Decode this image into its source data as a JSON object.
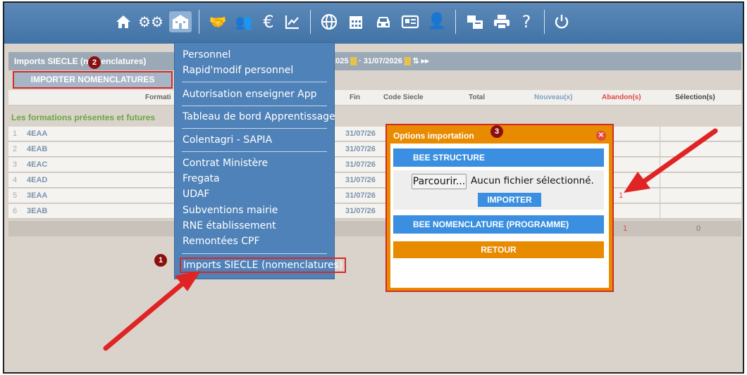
{
  "toolbar": {
    "icons": [
      "home-icon",
      "settings-icon",
      "school-icon",
      "handshake-icon",
      "group-icon",
      "euro-icon",
      "chart-icon",
      "globe-icon",
      "calendar-icon",
      "car-icon",
      "id-card-icon",
      "user-clock-icon",
      "mail-print-icon",
      "printer-icon",
      "help-icon",
      "power-icon"
    ],
    "glyph_help": "?",
    "glyph_euro": "€"
  },
  "page": {
    "title": "Imports SIECLE (nomenclatures)",
    "date_start": "2025",
    "date_end": "31/07/2026",
    "import_button": "IMPORTER NOMENCLATURES"
  },
  "table": {
    "headers": {
      "formation": "Formati",
      "fin": "Fin",
      "code_siecle": "Code Siecle",
      "total": "Total",
      "nouveaux": "Nouveau(x)",
      "abandons": "Abandon(s)",
      "selections": "Sélection(s)"
    },
    "group_label": "Les formations présentes et futures",
    "rows": [
      {
        "num": "1",
        "code": "4EAA",
        "fin": "31/07/26",
        "abandon": ""
      },
      {
        "num": "2",
        "code": "4EAB",
        "fin": "31/07/26",
        "abandon": ""
      },
      {
        "num": "3",
        "code": "4EAC",
        "fin": "31/07/26",
        "abandon": ""
      },
      {
        "num": "4",
        "code": "4EAD",
        "fin": "31/07/26",
        "abandon": ""
      },
      {
        "num": "5",
        "code": "3EAA",
        "fin": "31/07/26",
        "abandon": "1"
      },
      {
        "num": "6",
        "code": "3EAB",
        "fin": "31/07/26",
        "abandon": ""
      }
    ],
    "totals": {
      "abandons": "1",
      "selections": "0"
    }
  },
  "menu": {
    "items": [
      "Personnel",
      "Rapid'modif personnel",
      "Autorisation enseigner App",
      "Tableau de bord Apprentissage",
      "Colentagri - SAPIA",
      "Contrat Ministère",
      "Fregata",
      "UDAF",
      "Subventions mairie",
      "RNE établissement",
      "Remontées CPF",
      "Imports SIECLE (nomenclatures)"
    ]
  },
  "modal": {
    "title": "Options importation",
    "bee_structure": "BEE STRUCTURE",
    "browse": "Parcourir...",
    "file_status": "Aucun fichier sélectionné.",
    "importer": "IMPORTER",
    "bee_nomenclature": "BEE NOMENCLATURE (PROGRAMME)",
    "retour": "RETOUR"
  },
  "badges": [
    "1",
    "2",
    "3"
  ],
  "colors": {
    "toolbar": "#4a7bb0",
    "menu": "#4f82b8",
    "modal_accent": "#e88b00",
    "button_blue": "#3a8fe0",
    "annotation_red": "#d42a2a",
    "badge": "#8a1010"
  }
}
